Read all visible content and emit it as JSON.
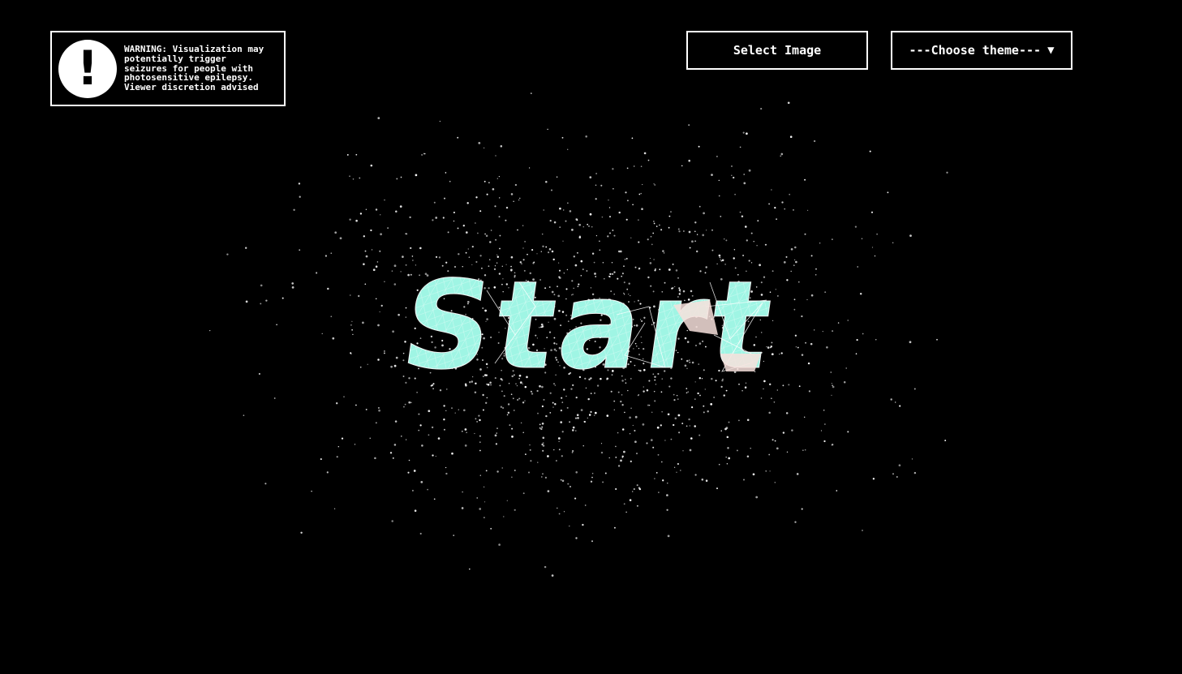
{
  "warning": {
    "icon": "exclamation-icon",
    "text": "WARNING: Visualization may\npotentially trigger\nseizures for people with\nphotosensitive epilepsy.\nViewer discretion advised"
  },
  "controls": {
    "select_image_label": "Select Image",
    "theme_select_value": "---Choose theme---",
    "theme_caret": "▼"
  },
  "start": {
    "label": "Start"
  },
  "colors": {
    "background": "#000000",
    "foreground": "#ffffff",
    "mesh_fill": "#9ff5e4",
    "mesh_accent": "#f7e1dc"
  }
}
